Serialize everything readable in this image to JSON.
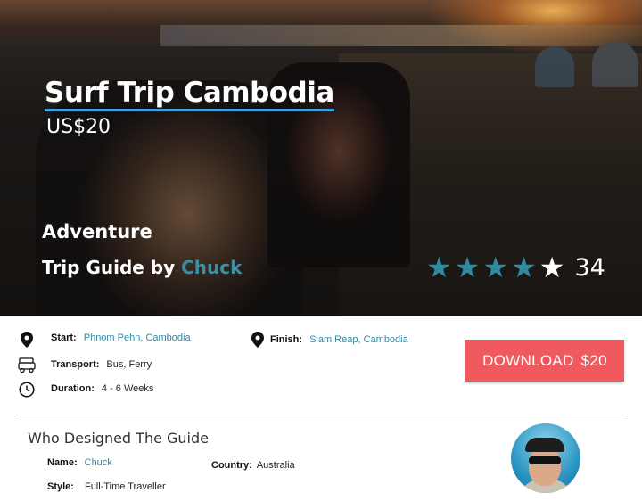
{
  "hero": {
    "title": "Surf Trip Cambodia",
    "price": "US$20",
    "category": "Adventure",
    "guide_by_prefix": "Trip Guide by",
    "author": "Chuck",
    "rating": {
      "stars_filled": 4,
      "stars_total": 5,
      "count": "34"
    }
  },
  "details": {
    "start": {
      "label": "Start:",
      "value": "Phnom Pehn, Cambodia"
    },
    "finish": {
      "label": "Finish:",
      "value": "Siam Reap, Cambodia"
    },
    "transport": {
      "label": "Transport:",
      "value": "Bus, Ferry"
    },
    "duration": {
      "label": "Duration:",
      "value": "4 - 6 Weeks"
    }
  },
  "download": {
    "label": "DOWNLOAD",
    "price": "$20"
  },
  "designer": {
    "heading": "Who Designed The Guide",
    "name": {
      "label": "Name:",
      "value": "Chuck"
    },
    "country": {
      "label": "Country:",
      "value": "Australia"
    },
    "style": {
      "label": "Style:",
      "value": "Full-Time Traveller"
    }
  },
  "colors": {
    "accent_teal": "#2f8aa4",
    "download_red": "#f05a5e",
    "title_underline": "#3fa3d9"
  },
  "icons": {
    "start": "map-pin-icon",
    "finish": "map-pin-icon",
    "transport": "vehicle-icon",
    "duration": "clock-icon"
  }
}
